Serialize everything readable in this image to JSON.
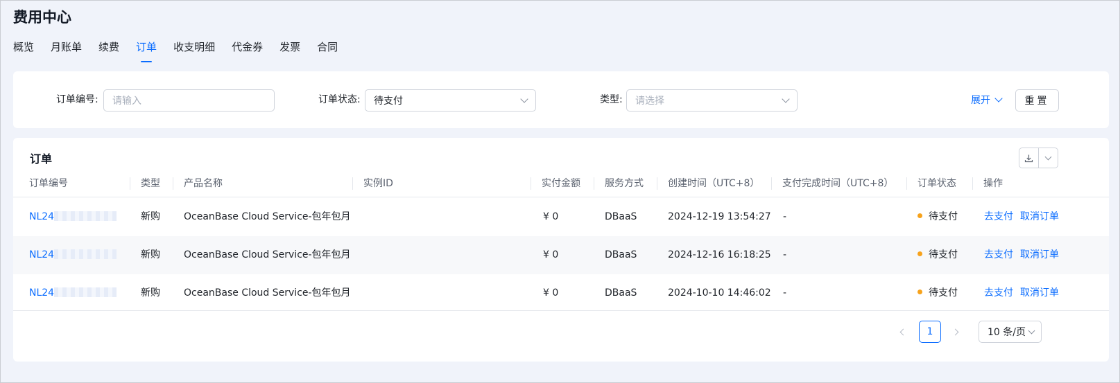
{
  "header": {
    "title": "费用中心"
  },
  "tabs": [
    {
      "label": "概览",
      "active": false
    },
    {
      "label": "月账单",
      "active": false
    },
    {
      "label": "续费",
      "active": false
    },
    {
      "label": "订单",
      "active": true
    },
    {
      "label": "收支明细",
      "active": false
    },
    {
      "label": "代金券",
      "active": false
    },
    {
      "label": "发票",
      "active": false
    },
    {
      "label": "合同",
      "active": false
    }
  ],
  "filters": {
    "order_no": {
      "label": "订单编号:",
      "placeholder": "请输入"
    },
    "status": {
      "label": "订单状态:",
      "value": "待支付"
    },
    "type": {
      "label": "类型:",
      "placeholder": "请选择"
    },
    "expand_label": "展开",
    "reset_label": "重置"
  },
  "table": {
    "title": "订单",
    "columns": [
      "订单编号",
      "类型",
      "产品名称",
      "实例ID",
      "实付金额",
      "服务方式",
      "创建时间（UTC+8）",
      "支付完成时间（UTC+8）",
      "订单状态",
      "操作"
    ],
    "rows": [
      {
        "order_no": "NL24",
        "type": "新购",
        "product": "OceanBase Cloud Service-包年包月",
        "instance_id": "",
        "amount": "¥ 0",
        "service": "DBaaS",
        "created": "2024-12-19 13:54:27",
        "paid": "-",
        "status": "待支付",
        "op_pay": "去支付",
        "op_cancel": "取消订单"
      },
      {
        "order_no": "NL24",
        "type": "新购",
        "product": "OceanBase Cloud Service-包年包月",
        "instance_id": "",
        "amount": "¥ 0",
        "service": "DBaaS",
        "created": "2024-12-16 16:18:25",
        "paid": "-",
        "status": "待支付",
        "op_pay": "去支付",
        "op_cancel": "取消订单"
      },
      {
        "order_no": "NL24",
        "type": "新购",
        "product": "OceanBase Cloud Service-包年包月",
        "instance_id": "",
        "amount": "¥ 0",
        "service": "DBaaS",
        "created": "2024-10-10 14:46:02",
        "paid": "-",
        "status": "待支付",
        "op_pay": "去支付",
        "op_cancel": "取消订单"
      }
    ]
  },
  "pagination": {
    "current_page": "1",
    "page_size": "10 条/页"
  },
  "colors": {
    "primary": "#0a6cff",
    "pending_dot": "#f7a21b",
    "page_bg": "#f0f3fa"
  }
}
